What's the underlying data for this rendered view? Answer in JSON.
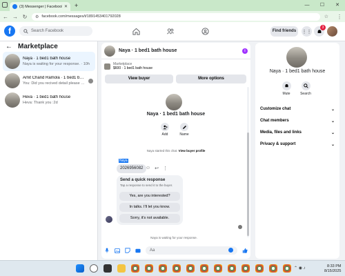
{
  "browser": {
    "tab_title": "(3) Messenger | Facebook",
    "url": "facebook.com/messages/t/1891453401792028"
  },
  "fb": {
    "search_placeholder": "Search Facebook",
    "find_friends": "Find friends",
    "notif_count": "3"
  },
  "sidebar": {
    "title": "Marketplace",
    "conversations": [
      {
        "title": "Naya · 1 bed1 bath house",
        "subtitle": "Naya is waiting for your response. · 10h"
      },
      {
        "title": "Amit Chand Ramola · 1 bed1 bat...",
        "subtitle": "You: Did you recived detail please for..."
      },
      {
        "title": "Heva · 1 bed1 bath house",
        "subtitle": "Heva: Thank you :2d"
      }
    ]
  },
  "chat": {
    "title": "Naya · 1 bed1 bath house",
    "listing_label": "Marketplace",
    "listing_detail": "$600 · 1 bed1 bath house",
    "view_buyer": "View buyer",
    "more_options": "More options",
    "hero_title": "Naya · 1 bed1 bath house",
    "add_label": "Add",
    "name_label": "Name",
    "system_text": "Naya started this chat.",
    "system_link": "View buyer profile",
    "sender_name": "Naya",
    "message": "2026956082",
    "quick_title": "Send a quick response",
    "quick_sub": "Tap a response to send it to the buyer.",
    "quick_replies": [
      "Yes, are you interested?",
      "In talks. I'll let you know.",
      "Sorry, it's not available."
    ],
    "waiting": "Naya is waiting for your response.",
    "composer_placeholder": "Aa"
  },
  "right": {
    "title": "Naya · 1 bed1 bath house",
    "mute": "Mute",
    "search": "Search",
    "sections": [
      "Customize chat",
      "Chat members",
      "Media, files and links",
      "Privacy & support"
    ]
  },
  "taskbar": {
    "time": "8:33 PM",
    "date": "8/15/2025"
  },
  "colors": {
    "fb_blue": "#1877f2",
    "chrome_green": "#c9e8c9"
  }
}
